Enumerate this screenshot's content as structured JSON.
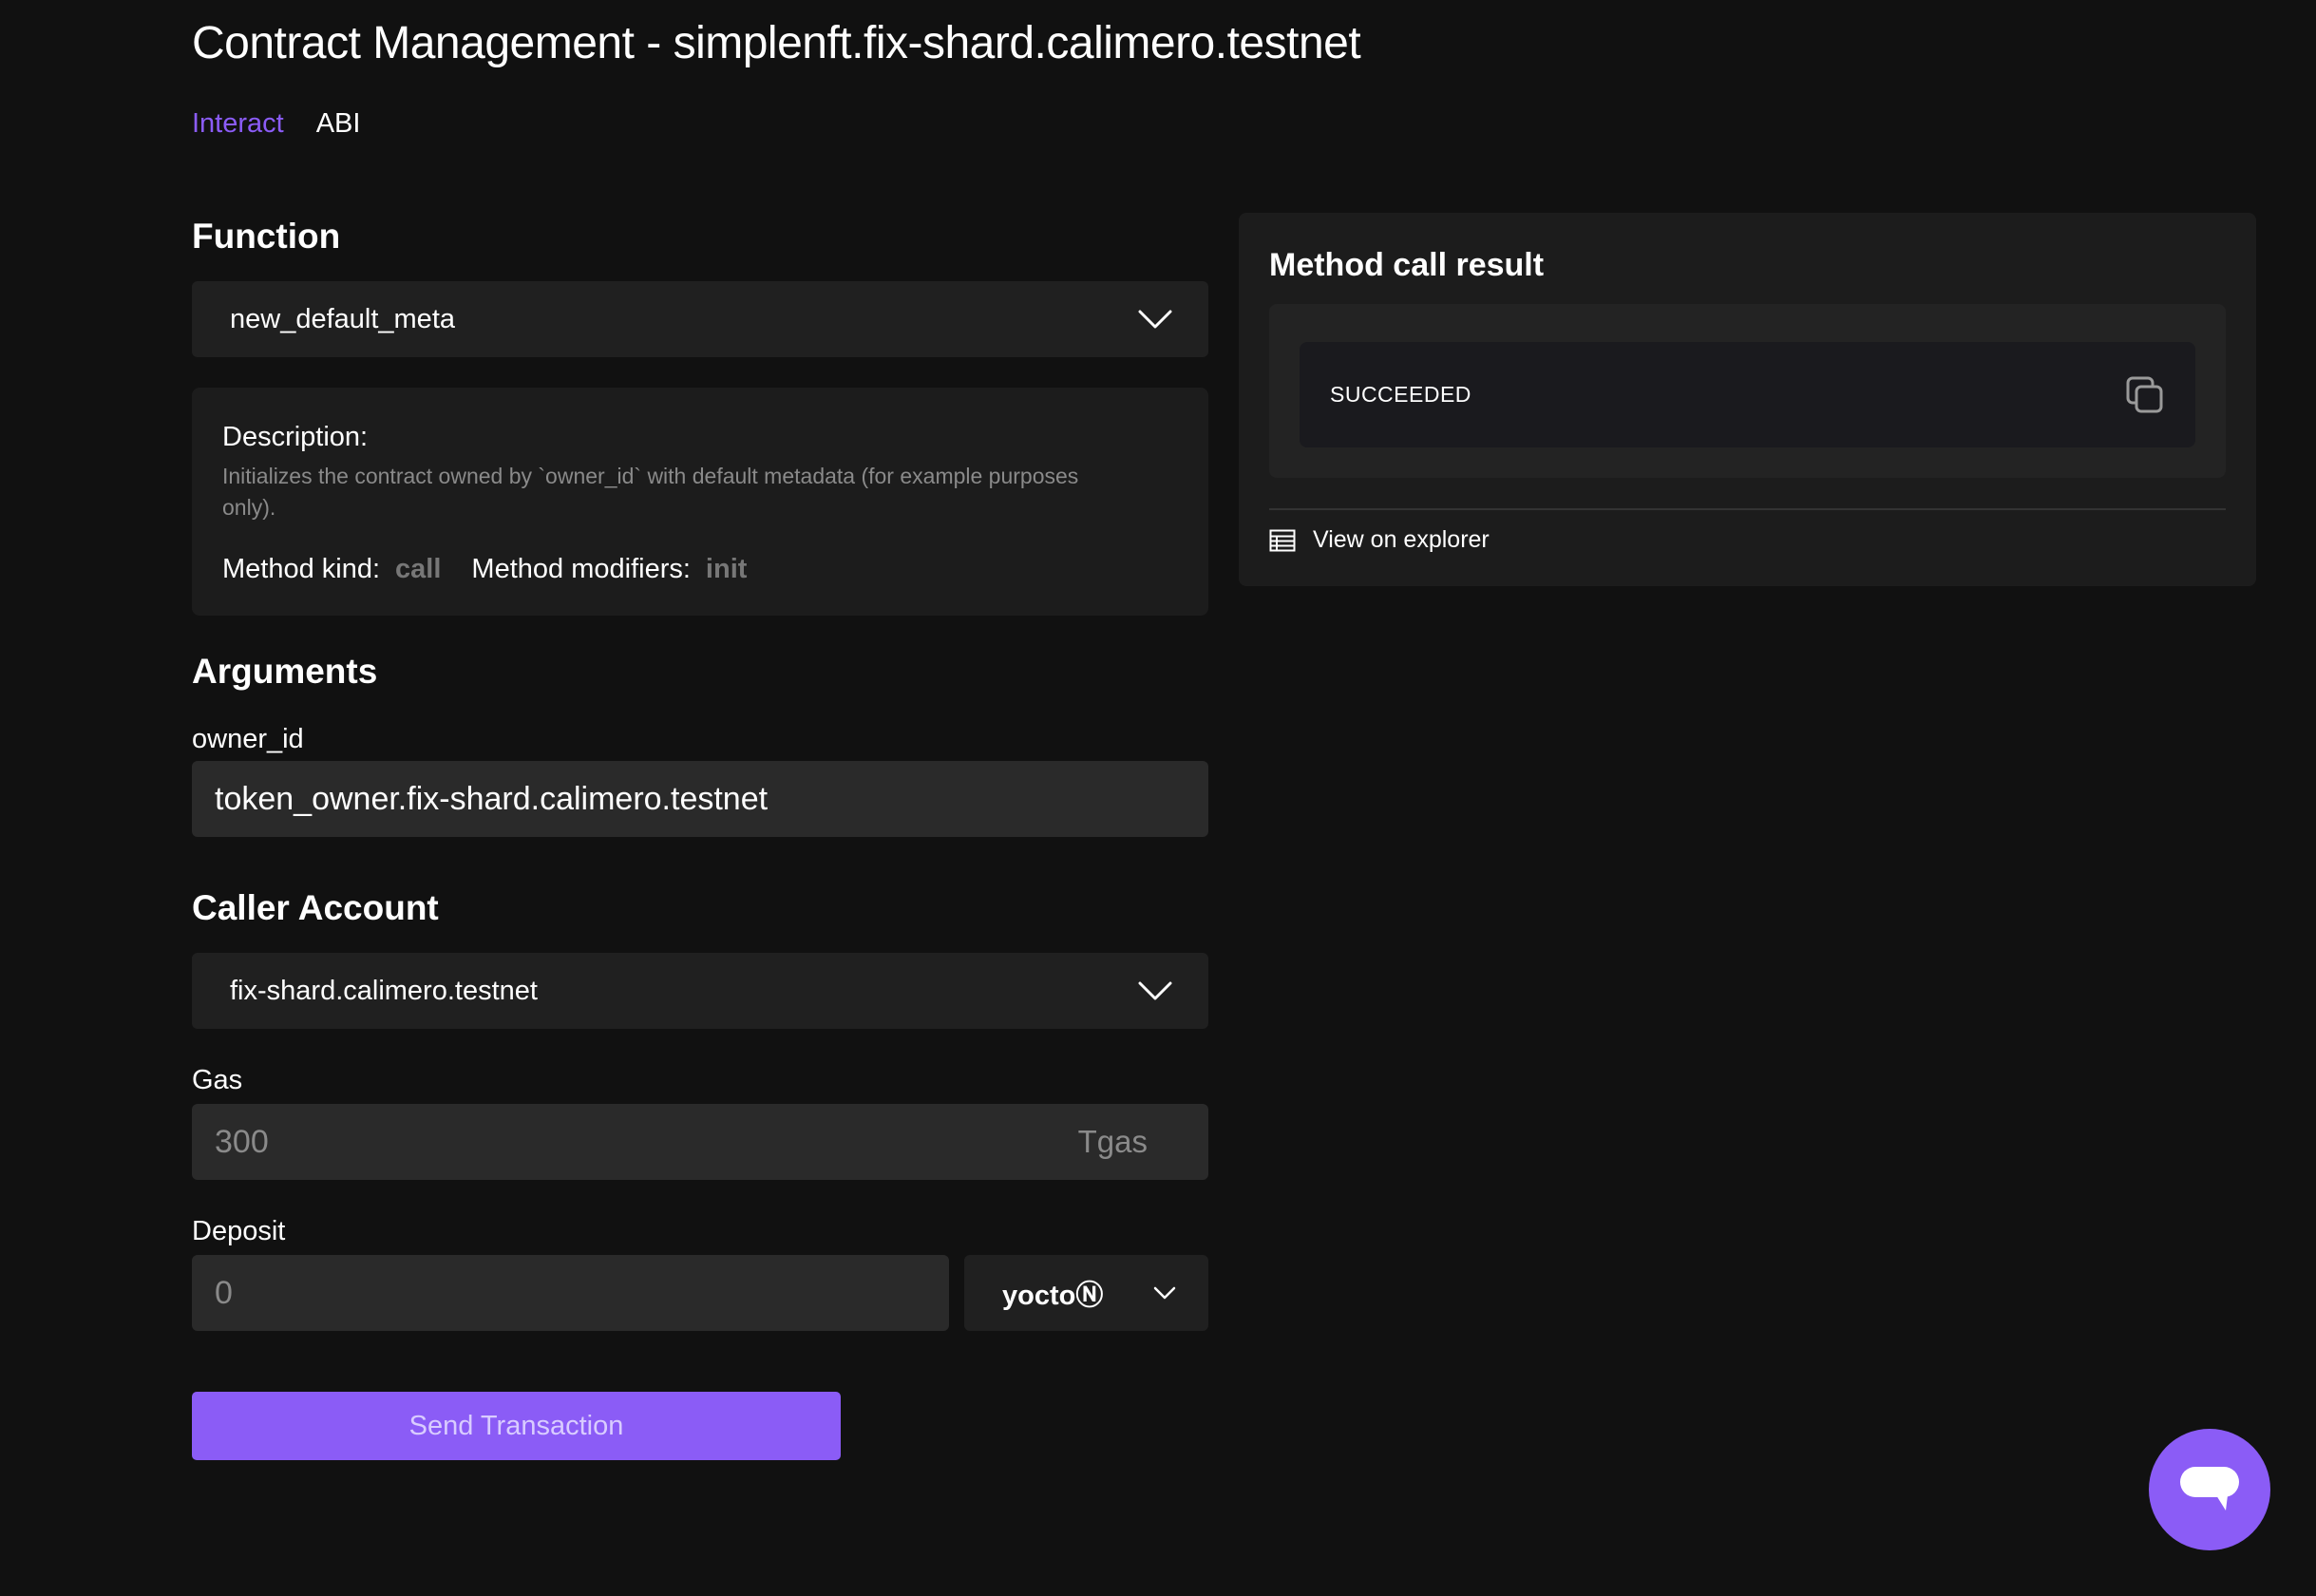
{
  "header": {
    "title": "Contract Management - simplenft.fix-shard.calimero.testnet",
    "tabs": [
      {
        "label": "Interact",
        "active": true
      },
      {
        "label": "ABI",
        "active": false
      }
    ]
  },
  "function": {
    "heading": "Function",
    "selected": "new_default_meta",
    "description_label": "Description:",
    "description_text": "Initializes the contract owned by `owner_id` with default metadata (for example purposes only).",
    "method_kind_label": "Method kind:",
    "method_kind_value": "call",
    "method_modifiers_label": "Method modifiers:",
    "method_modifiers_value": "init"
  },
  "arguments": {
    "heading": "Arguments",
    "owner_id_label": "owner_id",
    "owner_id_value": "token_owner.fix-shard.calimero.testnet"
  },
  "caller": {
    "heading": "Caller Account",
    "selected": "fix-shard.calimero.testnet",
    "gas_label": "Gas",
    "gas_value": "300",
    "gas_unit": "Tgas",
    "deposit_label": "Deposit",
    "deposit_value": "0",
    "deposit_unit": "yoctoⓃ"
  },
  "actions": {
    "send_label": "Send Transaction"
  },
  "result": {
    "title": "Method call result",
    "status": "SUCCEEDED",
    "explorer_label": "View on explorer"
  },
  "colors": {
    "accent": "#8b5cf6",
    "background": "#111111",
    "panel": "#1c1c1c",
    "muted_text": "#8a8a8a"
  },
  "icons": [
    "chevron-down-icon",
    "copy-icon",
    "table-icon",
    "chat-icon"
  ]
}
